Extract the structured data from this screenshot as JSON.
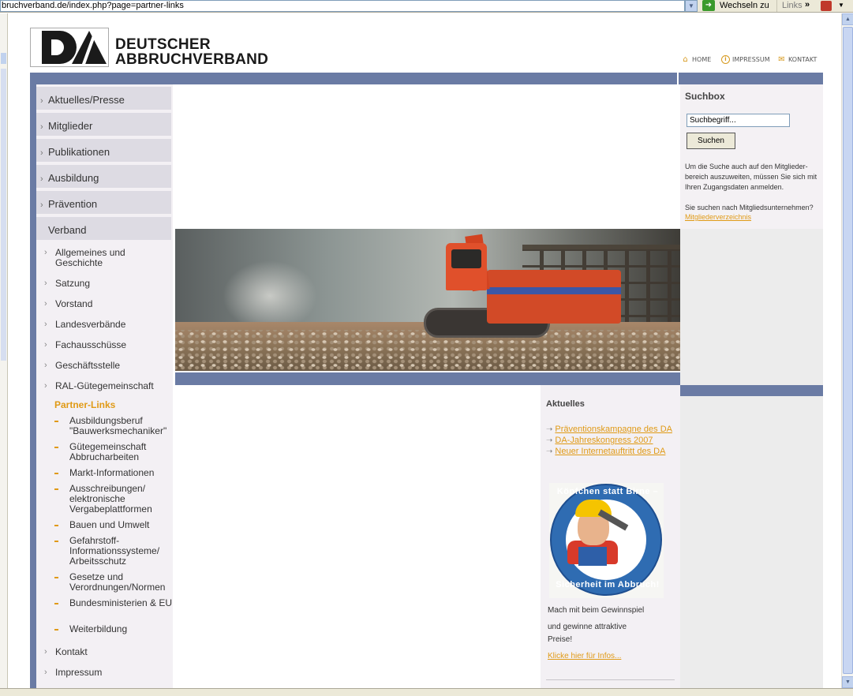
{
  "browser": {
    "address": "bruchverband.de/index.php?page=partner-links",
    "go_label": "Wechseln zu",
    "links_label": "Links",
    "links_more": "»"
  },
  "site": {
    "logo_text_line1": "DEUTSCHER",
    "logo_text_line2": "ABBRUCHVERBAND",
    "logo_letters": "DA"
  },
  "topnav": {
    "home": "HOME",
    "impressum": "IMPRESSUM",
    "kontakt": "KONTAKT"
  },
  "leftnav": {
    "main_items": [
      {
        "label": "Aktuelles/Presse"
      },
      {
        "label": "Mitglieder"
      },
      {
        "label": "Publikationen"
      },
      {
        "label": "Ausbildung"
      },
      {
        "label": "Prävention"
      },
      {
        "label": "Verband"
      }
    ],
    "sub_items": [
      {
        "label": "Allgemeines und Geschichte"
      },
      {
        "label": "Satzung"
      },
      {
        "label": "Vorstand"
      },
      {
        "label": "Landesverbände"
      },
      {
        "label": "Fachausschüsse"
      },
      {
        "label": "Geschäftsstelle"
      },
      {
        "label": "RAL-Gütegemeinschaft"
      }
    ],
    "current": "Partner-Links",
    "subsub_items": [
      {
        "label": "Ausbildungsberuf \"Bauwerksmechaniker\""
      },
      {
        "label": "Gütegemeinschaft Abbrucharbeiten"
      },
      {
        "label": "Markt-Informationen"
      },
      {
        "label": "Ausschreibungen/ elektronische Vergabeplattformen"
      },
      {
        "label": "Bauen und Umwelt"
      },
      {
        "label": "Gefahrstoff-Informationssysteme/ Arbeitsschutz"
      },
      {
        "label": "Gesetze und Verordnungen/Normen"
      },
      {
        "label": "Bundesministerien & EU"
      },
      {
        "label": "Weiterbildung"
      }
    ],
    "footer_items": [
      {
        "label": "Kontakt"
      },
      {
        "label": "Impressum"
      }
    ]
  },
  "searchbox": {
    "title": "Suchbox",
    "input_value": "Suchbegriff...",
    "button_label": "Suchen",
    "note": "Um die Suche auch auf den Mitglieder-bereich auszuweiten, müssen Sie sich mit Ihren Zugangsdaten anmelden.",
    "note2": "Sie suchen nach Mitgliedsunternehmen?",
    "link": "Mitgliederverzeichnis"
  },
  "news": {
    "title": "Aktuelles",
    "items": [
      {
        "label": "Präventionskampagne des DA"
      },
      {
        "label": "DA-Jahreskongress 2007"
      },
      {
        "label": "Neuer Internetauftritt des DA"
      }
    ],
    "badge_top": "Köpfchen statt Birne –",
    "badge_bottom": "Sicherheit im Abbruch!",
    "text1": "Mach mit beim Gewinnspiel",
    "text2": "und gewinne attraktive",
    "text3": "Preise!",
    "link": "Klicke hier für Infos..."
  },
  "colors": {
    "accent": "#e09a16",
    "bar": "#6a7ba4",
    "nav_bg": "#dddbe3"
  }
}
